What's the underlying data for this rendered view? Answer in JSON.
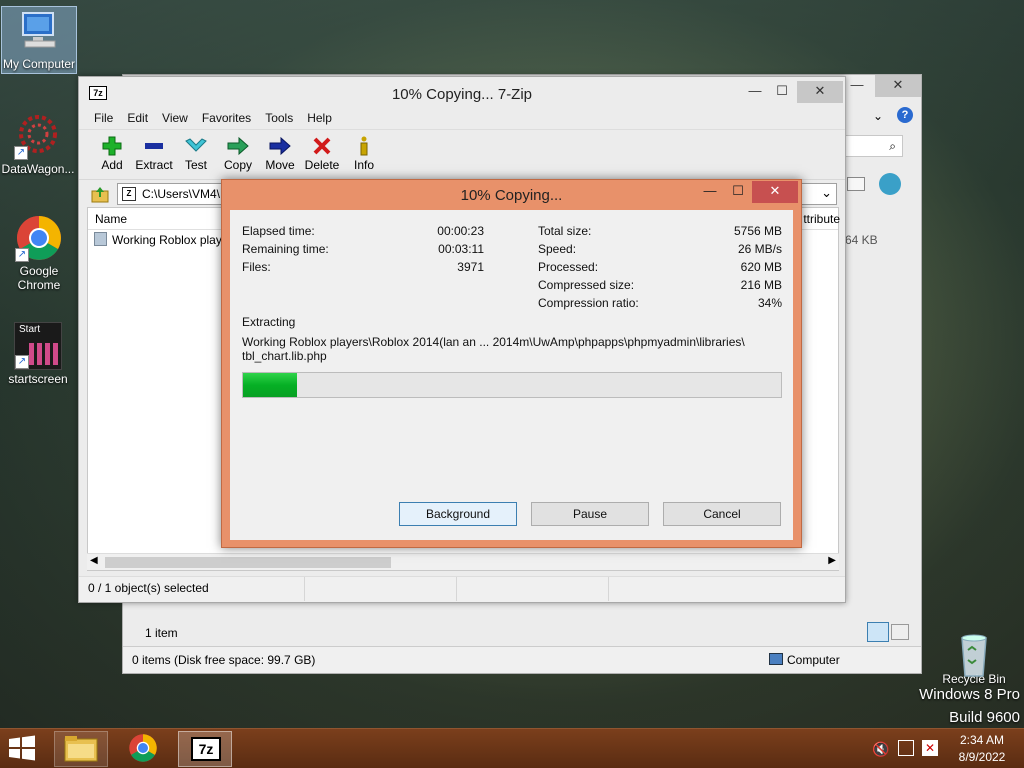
{
  "desktop": {
    "icons": [
      {
        "label": "My Computer"
      },
      {
        "label": "DataWagon..."
      },
      {
        "label": "Google Chrome"
      },
      {
        "label": "startscreen",
        "tile_text": "Start"
      },
      {
        "label": "Recycle Bin"
      }
    ],
    "watermark": {
      "line1": "Windows 8 Pro",
      "line2": "Build 9600"
    }
  },
  "explorer_bg": {
    "item_count": "1 item",
    "status_left": "0 items (Disk free space: 99.7 GB)",
    "status_right": "Computer",
    "size_col": "64 KB"
  },
  "zip_window": {
    "title": "10% Copying... 7-Zip",
    "app_icon": "7z",
    "menu": [
      "File",
      "Edit",
      "View",
      "Favorites",
      "Tools",
      "Help"
    ],
    "toolbar": [
      {
        "label": "Add",
        "icon": "plus-icon",
        "color": "#1db12a"
      },
      {
        "label": "Extract",
        "icon": "minus-icon",
        "color": "#1a2fa0"
      },
      {
        "label": "Test",
        "icon": "check-icon",
        "color": "#22a6b8"
      },
      {
        "label": "Copy",
        "icon": "arrow-right-icon",
        "color": "#2aa05a"
      },
      {
        "label": "Move",
        "icon": "arrow-right-icon",
        "color": "#1a2fa0"
      },
      {
        "label": "Delete",
        "icon": "x-icon",
        "color": "#d11a1a"
      },
      {
        "label": "Info",
        "icon": "info-icon",
        "color": "#c8a400"
      }
    ],
    "address": "C:\\Users\\VM4\\",
    "columns": {
      "name": "Name",
      "attributes": "ttribute"
    },
    "files": [
      {
        "name": "Working Roblox players"
      }
    ],
    "status": "0 / 1 object(s) selected"
  },
  "dialog": {
    "title": "10% Copying...",
    "left_stats": [
      {
        "label": "Elapsed time:",
        "value": "00:00:23"
      },
      {
        "label": "Remaining time:",
        "value": "00:03:11"
      },
      {
        "label": "Files:",
        "value": "3971"
      }
    ],
    "right_stats": [
      {
        "label": "Total size:",
        "value": "5756 MB"
      },
      {
        "label": "Speed:",
        "value": "26 MB/s"
      },
      {
        "label": "Processed:",
        "value": "620 MB"
      },
      {
        "label": "Compressed size:",
        "value": "216 MB"
      },
      {
        "label": "Compression ratio:",
        "value": "34%"
      }
    ],
    "operation": "Extracting",
    "path_line1": "Working Roblox players\\Roblox 2014(lan an ... 2014m\\UwAmp\\phpapps\\phpmyadmin\\libraries\\",
    "path_line2": "tbl_chart.lib.php",
    "progress_fraction": 0.1,
    "buttons": {
      "background": "Background",
      "pause": "Pause",
      "cancel": "Cancel"
    }
  },
  "taskbar": {
    "clock_time": "2:34 AM",
    "clock_date": "8/9/2022",
    "zip_label": "7z"
  }
}
